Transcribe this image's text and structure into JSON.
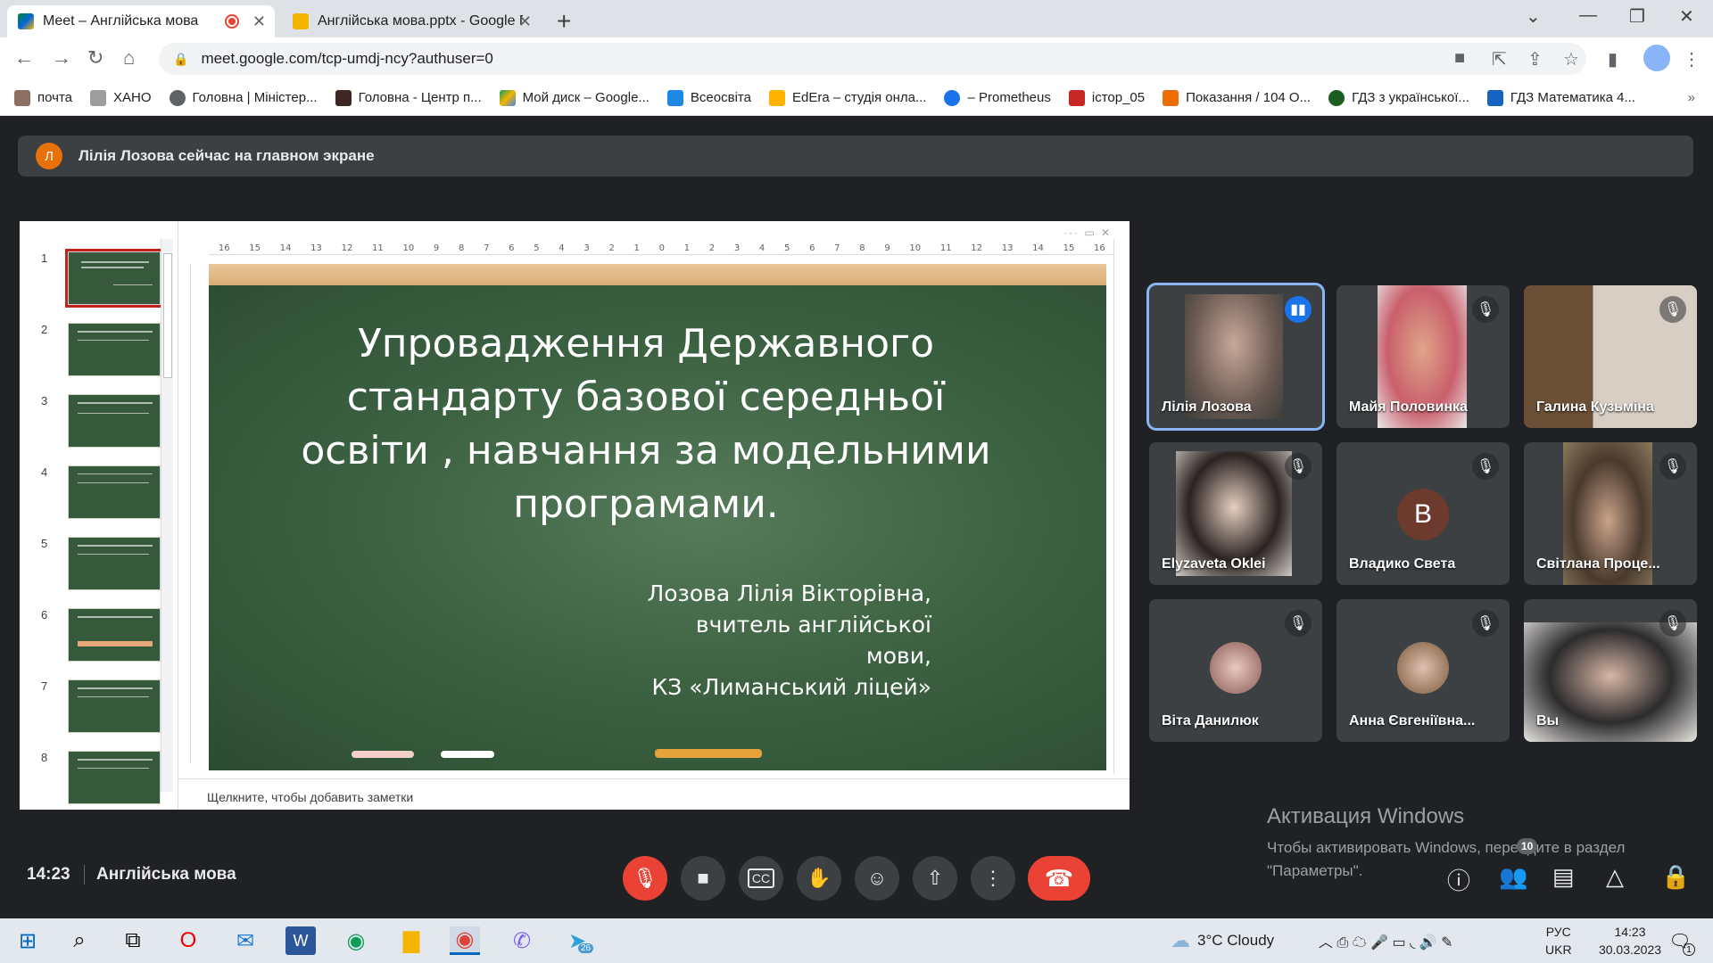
{
  "browser": {
    "tabs": [
      {
        "title": "Meet – Англійська мова",
        "recording": true
      },
      {
        "title": "Англійська мова.pptx - Google П"
      }
    ],
    "url": "meet.google.com/tcp-umdj-ncy?authuser=0",
    "bookmarks": [
      "почта",
      "ХАНО",
      "Головна | Міністер...",
      "Головна - Центр п...",
      "Мой диск – Google...",
      "Всеосвіта",
      "EdEra – студія онла...",
      "– Prometheus",
      "істор_05",
      "Показання / 104 О...",
      "ГДЗ з української...",
      "ГДЗ Математика 4..."
    ]
  },
  "meet": {
    "banner": {
      "initial": "Л",
      "text": "Лілія Лозова сейчас на главном экране"
    },
    "presentation": {
      "slide_title": "Упровадження Державного стандарту базової середньої освіти , навчання за модельними програмами.",
      "author_lines": [
        "Лозова Лілія Вікторівна,",
        "вчитель англійської мови,",
        "КЗ «Лиманський ліцей»"
      ],
      "notes_placeholder": "Щелкните, чтобы добавить заметки",
      "slide_numbers": [
        "1",
        "2",
        "3",
        "4",
        "5",
        "6",
        "7",
        "8"
      ],
      "ruler": [
        "16",
        "15",
        "14",
        "13",
        "12",
        "11",
        "10",
        "9",
        "8",
        "7",
        "6",
        "5",
        "4",
        "3",
        "2",
        "1",
        "0",
        "1",
        "2",
        "3",
        "4",
        "5",
        "6",
        "7",
        "8",
        "9",
        "10",
        "11",
        "12",
        "13",
        "14",
        "15",
        "16"
      ]
    },
    "participants": [
      {
        "name": "Лілія Лозова",
        "speaking": true
      },
      {
        "name": "Майя Половинка"
      },
      {
        "name": "Галина Кузьміна"
      },
      {
        "name": "Elyzaveta Oklei"
      },
      {
        "name": "Владико Света",
        "initial": "В"
      },
      {
        "name": "Світлана Проце..."
      },
      {
        "name": "Віта Данилюк"
      },
      {
        "name": "Анна Євгеніївна..."
      },
      {
        "name": "Вы"
      }
    ],
    "activation": {
      "title": "Активация Windows",
      "line1": "Чтобы активировать Windows, перейдите в раздел",
      "line2": "\"Параметры\"."
    },
    "time": "14:23",
    "meeting_name": "Англійська мова",
    "participants_count": "10"
  },
  "taskbar": {
    "weather": "3°C  Cloudy",
    "lang_top": "РУС",
    "lang_bottom": "UKR",
    "clock_time": "14:23",
    "clock_date": "30.03.2023",
    "notif_count": "1",
    "telegram_badge": "26"
  }
}
